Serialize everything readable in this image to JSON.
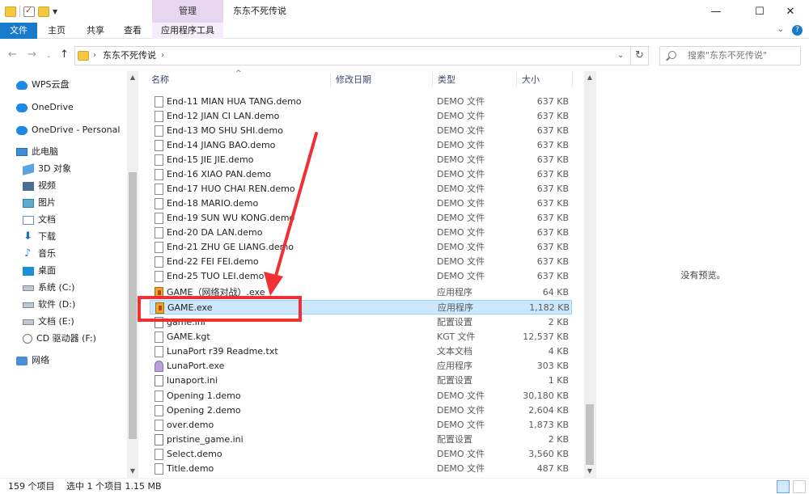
{
  "titlebar": {
    "title": "东东不死传说",
    "context_group": "管理",
    "controls": [
      "minimize-icon",
      "maximize-icon",
      "close-icon"
    ]
  },
  "ribbon": {
    "tabs": [
      "文件",
      "主页",
      "共享",
      "查看",
      "应用程序工具"
    ]
  },
  "address": {
    "path": "东东不死传说",
    "search_placeholder": "搜索\"东东不死传说\""
  },
  "nav": {
    "items": [
      {
        "label": "WPS云盘",
        "icon": "wps-cloud-icon"
      },
      {
        "label": "OneDrive",
        "icon": "onedrive-icon"
      },
      {
        "label": "OneDrive - Personal",
        "icon": "onedrive-icon"
      },
      {
        "label": "此电脑",
        "icon": "this-pc-icon"
      },
      {
        "label": "3D 对象",
        "icon": "3d-objects-icon"
      },
      {
        "label": "视频",
        "icon": "video-icon"
      },
      {
        "label": "图片",
        "icon": "pictures-icon"
      },
      {
        "label": "文档",
        "icon": "documents-icon"
      },
      {
        "label": "下载",
        "icon": "downloads-icon"
      },
      {
        "label": "音乐",
        "icon": "music-icon"
      },
      {
        "label": "桌面",
        "icon": "desktop-icon"
      },
      {
        "label": "系统 (C:)",
        "icon": "drive-icon"
      },
      {
        "label": "软件 (D:)",
        "icon": "drive-icon"
      },
      {
        "label": "文档 (E:)",
        "icon": "drive-icon"
      },
      {
        "label": "CD 驱动器 (F:)",
        "icon": "cd-drive-icon"
      },
      {
        "label": "网络",
        "icon": "network-icon"
      }
    ]
  },
  "columns": {
    "name": "名称",
    "modified": "修改日期",
    "type": "类型",
    "size": "大小"
  },
  "files": [
    {
      "name": "End-11 MIAN HUA TANG.demo",
      "type": "DEMO 文件",
      "size": "637 KB",
      "icon": "file-icon"
    },
    {
      "name": "End-12 JIAN CI LAN.demo",
      "type": "DEMO 文件",
      "size": "637 KB",
      "icon": "file-icon"
    },
    {
      "name": "End-13 MO SHU SHI.demo",
      "type": "DEMO 文件",
      "size": "637 KB",
      "icon": "file-icon"
    },
    {
      "name": "End-14 JIANG BAO.demo",
      "type": "DEMO 文件",
      "size": "637 KB",
      "icon": "file-icon"
    },
    {
      "name": "End-15 JIE JIE.demo",
      "type": "DEMO 文件",
      "size": "637 KB",
      "icon": "file-icon"
    },
    {
      "name": "End-16 XIAO PAN.demo",
      "type": "DEMO 文件",
      "size": "637 KB",
      "icon": "file-icon"
    },
    {
      "name": "End-17 HUO CHAI REN.demo",
      "type": "DEMO 文件",
      "size": "637 KB",
      "icon": "file-icon"
    },
    {
      "name": "End-18 MARIO.demo",
      "type": "DEMO 文件",
      "size": "637 KB",
      "icon": "file-icon"
    },
    {
      "name": "End-19 SUN WU KONG.demo",
      "type": "DEMO 文件",
      "size": "637 KB",
      "icon": "file-icon"
    },
    {
      "name": "End-20 DA LAN.demo",
      "type": "DEMO 文件",
      "size": "637 KB",
      "icon": "file-icon"
    },
    {
      "name": "End-21 ZHU GE LIANG.demo",
      "type": "DEMO 文件",
      "size": "637 KB",
      "icon": "file-icon"
    },
    {
      "name": "End-22 FEI FEI.demo",
      "type": "DEMO 文件",
      "size": "637 KB",
      "icon": "file-icon"
    },
    {
      "name": "End-25 TUO LEI.demo",
      "type": "DEMO 文件",
      "size": "637 KB",
      "icon": "file-icon"
    },
    {
      "name": "GAME（网络对战）.exe",
      "type": "应用程序",
      "size": "64 KB",
      "icon": "exe-icon"
    },
    {
      "name": "GAME.exe",
      "type": "应用程序",
      "size": "1,182 KB",
      "icon": "exe-icon",
      "selected": true
    },
    {
      "name": "game.ini",
      "type": "配置设置",
      "size": "2 KB",
      "icon": "ini-icon"
    },
    {
      "name": "GAME.kgt",
      "type": "KGT 文件",
      "size": "12,537 KB",
      "icon": "file-icon"
    },
    {
      "name": "LunaPort r39 Readme.txt",
      "type": "文本文档",
      "size": "4 KB",
      "icon": "txt-icon"
    },
    {
      "name": "LunaPort.exe",
      "type": "应用程序",
      "size": "303 KB",
      "icon": "lunaport-icon"
    },
    {
      "name": "lunaport.ini",
      "type": "配置设置",
      "size": "1 KB",
      "icon": "ini-icon"
    },
    {
      "name": "Opening 1.demo",
      "type": "DEMO 文件",
      "size": "30,180 KB",
      "icon": "file-icon"
    },
    {
      "name": "Opening 2.demo",
      "type": "DEMO 文件",
      "size": "2,604 KB",
      "icon": "file-icon"
    },
    {
      "name": "over.demo",
      "type": "DEMO 文件",
      "size": "1,873 KB",
      "icon": "file-icon"
    },
    {
      "name": "pristine_game.ini",
      "type": "配置设置",
      "size": "2 KB",
      "icon": "ini-icon"
    },
    {
      "name": "Select.demo",
      "type": "DEMO 文件",
      "size": "3,560 KB",
      "icon": "file-icon"
    },
    {
      "name": "Title.demo",
      "type": "DEMO 文件",
      "size": "487 KB",
      "icon": "file-icon"
    }
  ],
  "preview": {
    "text": "没有预览。"
  },
  "status": {
    "count": "159 个项目",
    "selection": "选中 1 个项目  1.15 MB"
  },
  "colors": {
    "accent": "#1979ca",
    "selection": "#cce8ff",
    "annotation": "#ef3035"
  }
}
